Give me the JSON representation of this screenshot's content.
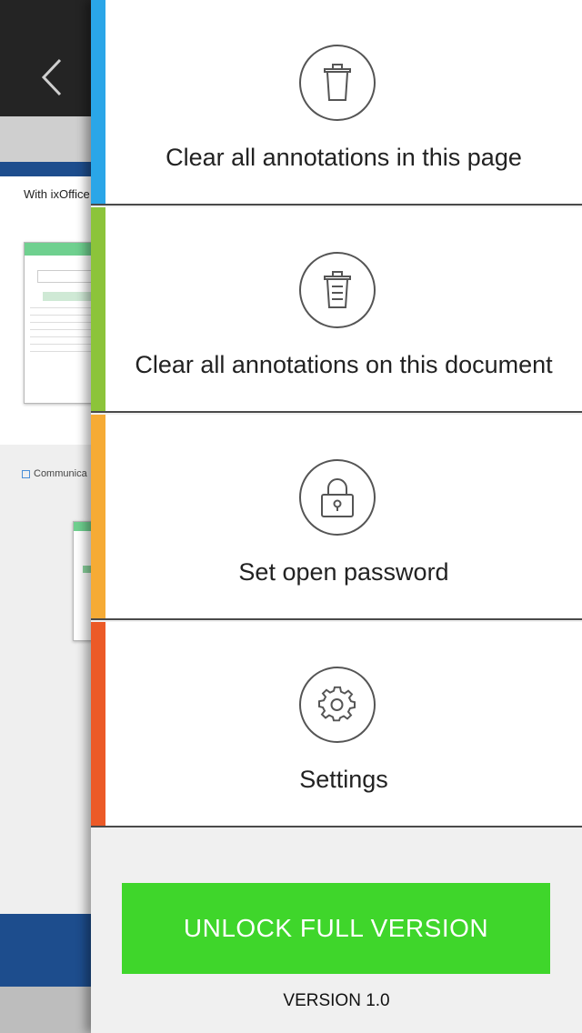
{
  "background": {
    "page_title": "With ixOffice",
    "section_label": "Communica"
  },
  "drawer": {
    "items": [
      {
        "label": "Clear all annotations in this page",
        "icon": "trash-icon",
        "accent": "#2aa6e8"
      },
      {
        "label": "Clear all annotations on this document",
        "icon": "document-trash-icon",
        "accent": "#8cc43a"
      },
      {
        "label": "Set open password",
        "icon": "lock-icon",
        "accent": "#f6ab35"
      },
      {
        "label": "Settings",
        "icon": "gear-icon",
        "accent": "#ec5a27"
      }
    ],
    "unlock_label": "UNLOCK FULL VERSION",
    "version": "VERSION 1.0"
  },
  "colors": {
    "unlock_green": "#3fd62b",
    "top_bar": "#242424",
    "doc_blue": "#1d4d8d"
  }
}
